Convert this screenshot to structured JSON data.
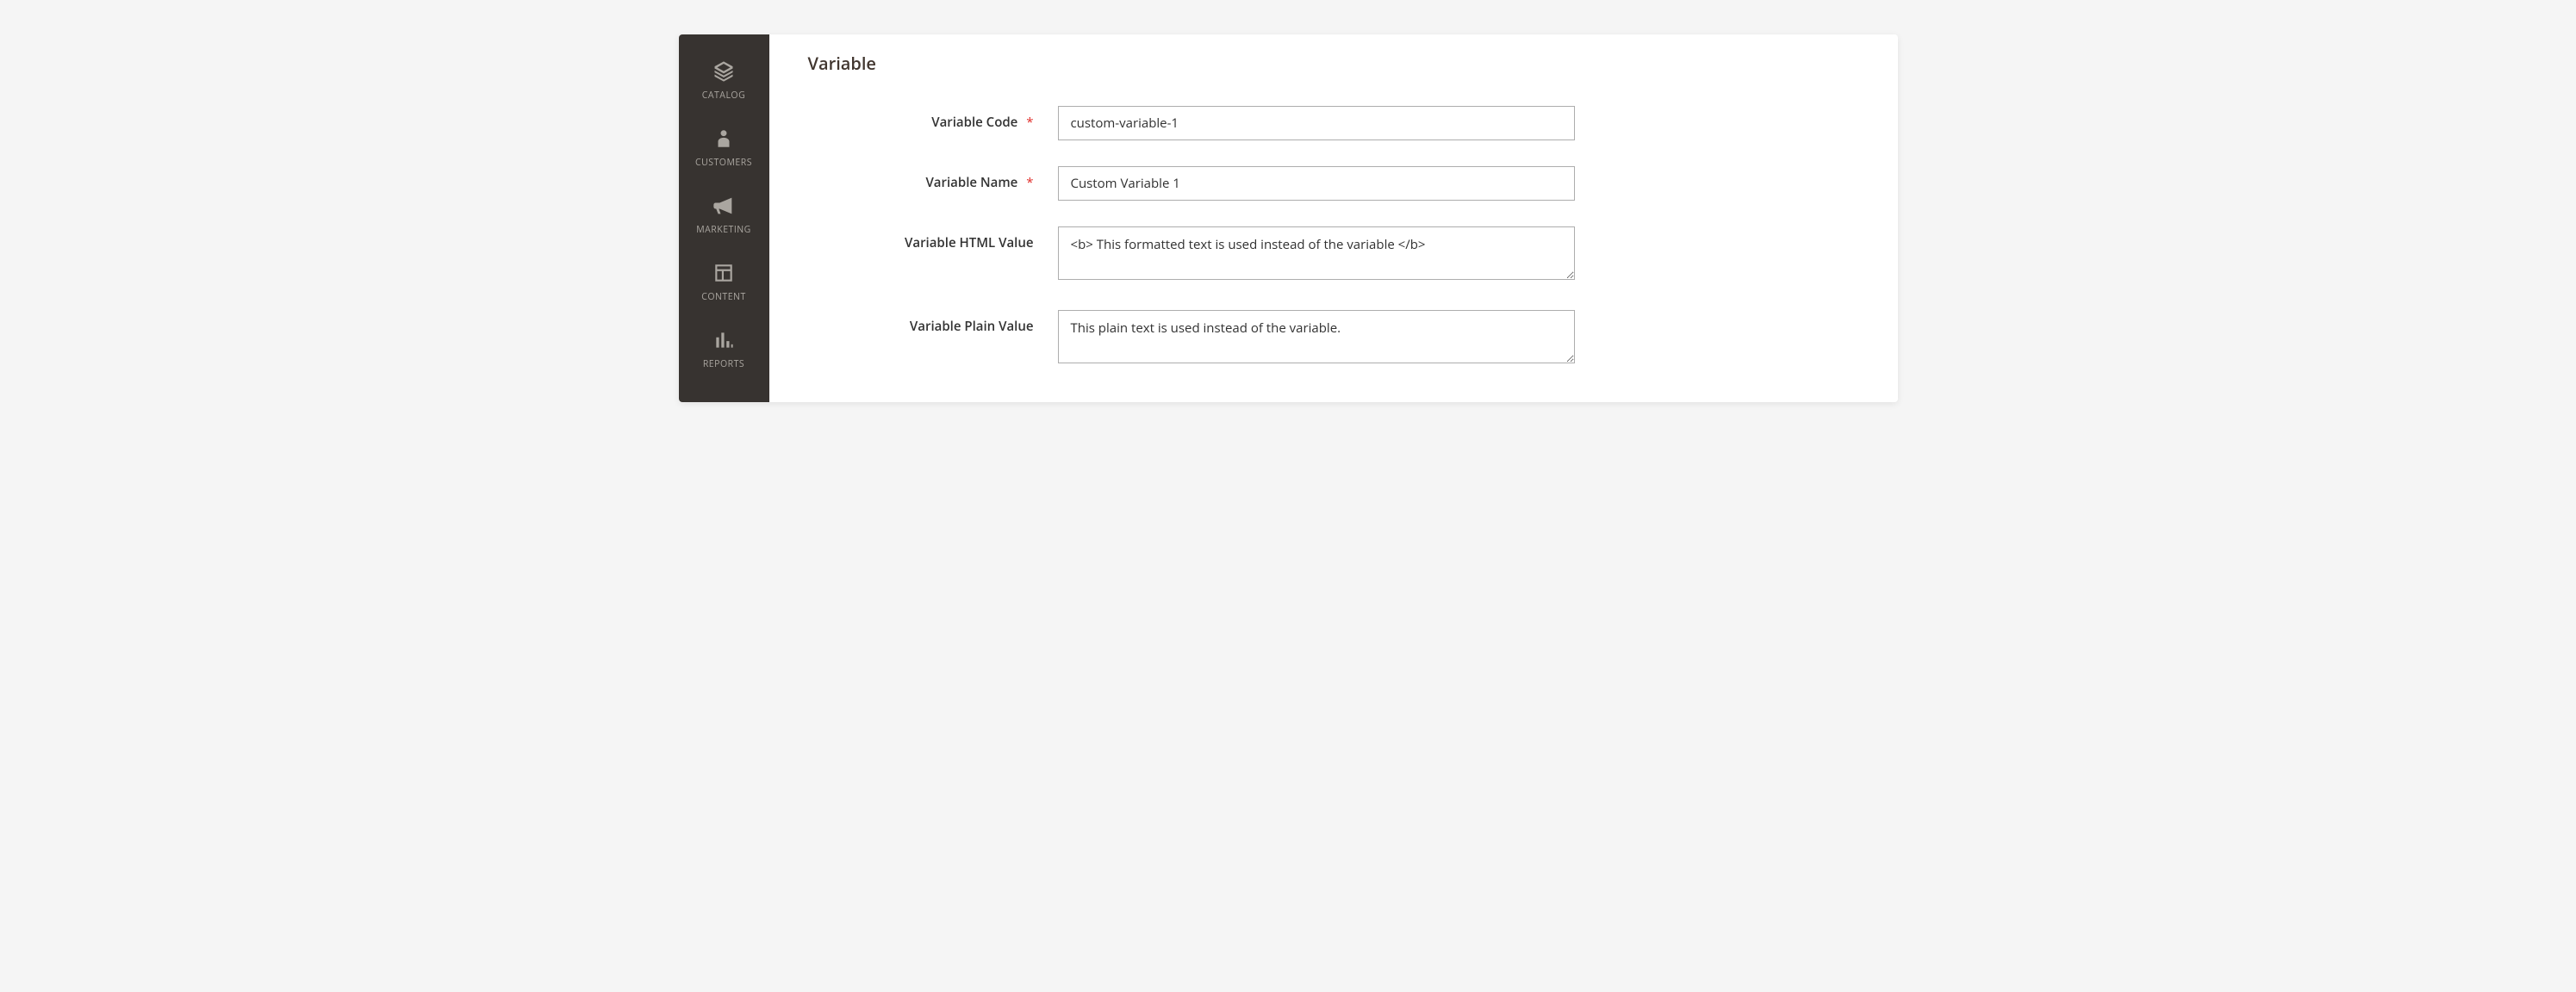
{
  "sidebar": {
    "items": [
      {
        "label": "CATALOG",
        "icon": "catalog-icon"
      },
      {
        "label": "CUSTOMERS",
        "icon": "customers-icon"
      },
      {
        "label": "MARKETING",
        "icon": "marketing-icon"
      },
      {
        "label": "CONTENT",
        "icon": "content-icon"
      },
      {
        "label": "REPORTS",
        "icon": "reports-icon"
      }
    ]
  },
  "page": {
    "title": "Variable"
  },
  "form": {
    "fields": {
      "code": {
        "label": "Variable Code",
        "required": true,
        "value": "custom-variable-1"
      },
      "name": {
        "label": "Variable Name",
        "required": true,
        "value": "Custom Variable 1"
      },
      "html_value": {
        "label": "Variable HTML Value",
        "required": false,
        "value": "<b> This formatted text is used instead of the variable </b>"
      },
      "plain_value": {
        "label": "Variable Plain Value",
        "required": false,
        "value": "This plain text is used instead of the variable."
      }
    }
  }
}
